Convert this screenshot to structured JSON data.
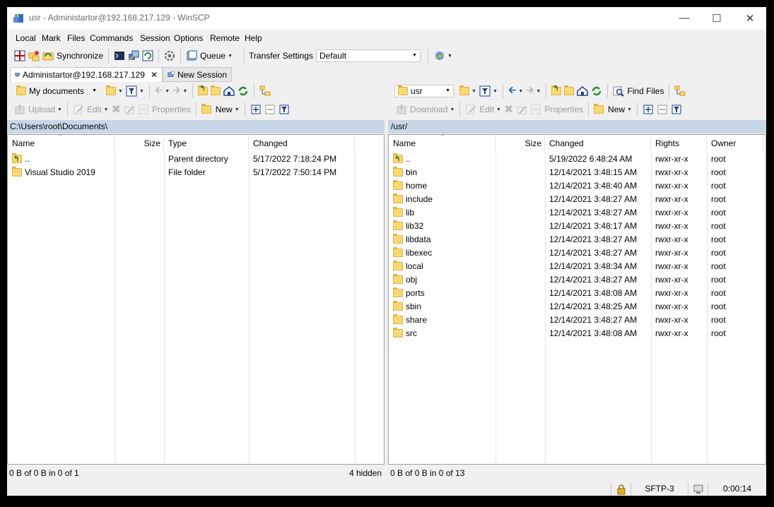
{
  "window": {
    "title": "usr - Administartor@192.168.217.129 - WinSCP"
  },
  "menu": [
    "Local",
    "Mark",
    "Files",
    "Commands",
    "Session",
    "Options",
    "Remote",
    "Help"
  ],
  "toolbar": {
    "synchronize": "Synchronize",
    "queue": "Queue",
    "transfer_settings_label": "Transfer Settings",
    "transfer_settings_value": "Default"
  },
  "tabs": {
    "session": "Administartor@192.168.217.129",
    "new_session": "New Session"
  },
  "left": {
    "location": "My documents",
    "upload": "Upload",
    "edit": "Edit",
    "properties": "Properties",
    "new": "New",
    "path": "C:\\Users\\root\\Documents\\",
    "columns": {
      "name": "Name",
      "size": "Size",
      "type": "Type",
      "changed": "Changed"
    },
    "rows": [
      {
        "name": "..",
        "size": "",
        "type": "Parent directory",
        "changed": "5/17/2022  7:18:24 PM"
      },
      {
        "name": "Visual Studio 2019",
        "size": "",
        "type": "File folder",
        "changed": "5/17/2022  7:50:14 PM"
      }
    ],
    "status": "0 B of 0 B in 0 of 1",
    "hidden": "4 hidden"
  },
  "right": {
    "location": "usr",
    "find_files": "Find Files",
    "download": "Download",
    "edit": "Edit",
    "properties": "Properties",
    "new": "New",
    "path": "/usr/",
    "columns": {
      "name": "Name",
      "size": "Size",
      "changed": "Changed",
      "rights": "Rights",
      "owner": "Owner"
    },
    "rows": [
      {
        "name": "..",
        "size": "",
        "changed": "5/19/2022 6:48:24 AM",
        "rights": "rwxr-xr-x",
        "owner": "root"
      },
      {
        "name": "bin",
        "size": "",
        "changed": "12/14/2021 3:48:15 AM",
        "rights": "rwxr-xr-x",
        "owner": "root"
      },
      {
        "name": "home",
        "size": "",
        "changed": "12/14/2021 3:48:40 AM",
        "rights": "rwxr-xr-x",
        "owner": "root"
      },
      {
        "name": "include",
        "size": "",
        "changed": "12/14/2021 3:48:27 AM",
        "rights": "rwxr-xr-x",
        "owner": "root"
      },
      {
        "name": "lib",
        "size": "",
        "changed": "12/14/2021 3:48:27 AM",
        "rights": "rwxr-xr-x",
        "owner": "root"
      },
      {
        "name": "lib32",
        "size": "",
        "changed": "12/14/2021 3:48:17 AM",
        "rights": "rwxr-xr-x",
        "owner": "root"
      },
      {
        "name": "libdata",
        "size": "",
        "changed": "12/14/2021 3:48:27 AM",
        "rights": "rwxr-xr-x",
        "owner": "root"
      },
      {
        "name": "libexec",
        "size": "",
        "changed": "12/14/2021 3:48:27 AM",
        "rights": "rwxr-xr-x",
        "owner": "root"
      },
      {
        "name": "local",
        "size": "",
        "changed": "12/14/2021 3:48:34 AM",
        "rights": "rwxr-xr-x",
        "owner": "root"
      },
      {
        "name": "obj",
        "size": "",
        "changed": "12/14/2021 3:48:27 AM",
        "rights": "rwxr-xr-x",
        "owner": "root"
      },
      {
        "name": "ports",
        "size": "",
        "changed": "12/14/2021 3:48:08 AM",
        "rights": "rwxr-xr-x",
        "owner": "root"
      },
      {
        "name": "sbin",
        "size": "",
        "changed": "12/14/2021 3:48:25 AM",
        "rights": "rwxr-xr-x",
        "owner": "root"
      },
      {
        "name": "share",
        "size": "",
        "changed": "12/14/2021 3:48:27 AM",
        "rights": "rwxr-xr-x",
        "owner": "root"
      },
      {
        "name": "src",
        "size": "",
        "changed": "12/14/2021 3:48:08 AM",
        "rights": "rwxr-xr-x",
        "owner": "root"
      }
    ],
    "status": "0 B of 0 B in 0 of 13"
  },
  "statusbar": {
    "protocol": "SFTP-3",
    "elapsed": "0:00:14"
  },
  "colors": {
    "path_bar": "#c8d7e6",
    "folder": "#f8d775",
    "accent_blue": "#2a6ebb"
  },
  "icons": [
    "winscp-app-icon",
    "minimize-icon",
    "maximize-icon",
    "close-icon",
    "folder-icon",
    "parent-directory-icon",
    "filter-icon",
    "refresh-icon",
    "home-icon",
    "back-icon",
    "forward-icon",
    "lock-icon",
    "computer-icon"
  ]
}
